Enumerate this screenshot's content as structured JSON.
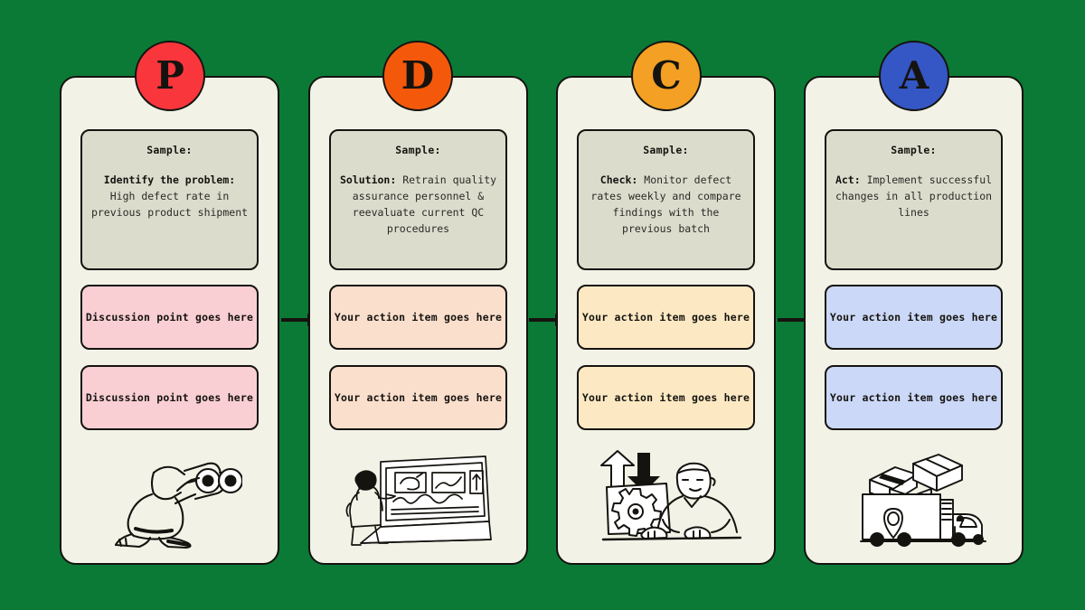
{
  "background_color": "#0b7a36",
  "card_color": "#f2f2e6",
  "sample_box_color": "#dcdccd",
  "outline_color": "#15130f",
  "columns": [
    {
      "letter": "P",
      "badge_color": "#f9363c",
      "item_color": "#f9cfd4",
      "sample_title": "Sample:",
      "sample_label": "Identify the problem:",
      "sample_text": " High defect rate in previous product shipment",
      "items": [
        "Discussion point goes here",
        "Discussion point goes here"
      ],
      "illustration": "person-with-binoculars-icon"
    },
    {
      "letter": "D",
      "badge_color": "#f4590b",
      "item_color": "#fbdfcd",
      "sample_title": "Sample:",
      "sample_label": "Solution:",
      "sample_text": " Retrain quality assurance personnel & reevaluate current QC procedures",
      "items": [
        "Your action item goes here",
        "Your action item goes here"
      ],
      "illustration": "person-at-laptop-presentation-icon"
    },
    {
      "letter": "C",
      "badge_color": "#f3a024",
      "item_color": "#fce9c4",
      "sample_title": "Sample:",
      "sample_label": "Check:",
      "sample_text": " Monitor defect rates weekly and compare findings with the previous batch",
      "items": [
        "Your action item goes here",
        "Your action item goes here"
      ],
      "illustration": "person-at-computer-with-gear-icon"
    },
    {
      "letter": "A",
      "badge_color": "#3457c5",
      "item_color": "#ccd8f7",
      "sample_title": "Sample:",
      "sample_label": "Act:",
      "sample_text": " Implement successful changes in all production lines",
      "items": [
        "Your action item goes here",
        "Your action item goes here"
      ],
      "illustration": "delivery-truck-with-boxes-icon"
    }
  ],
  "arrows": [
    {
      "name": "arrow-p-to-d"
    },
    {
      "name": "arrow-d-to-c"
    },
    {
      "name": "arrow-c-to-a"
    }
  ]
}
